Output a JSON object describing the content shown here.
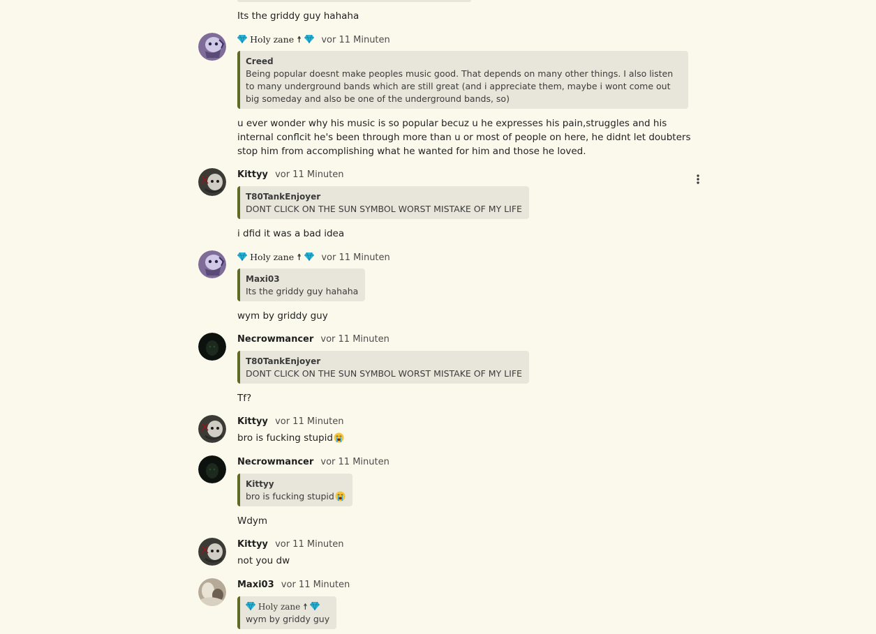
{
  "top_fragment": {
    "text": "Its the griddy guy hahaha"
  },
  "comments": [
    {
      "author": "Holy zane",
      "author_prefix_icon": "diamond-icon",
      "author_suffix": "☨",
      "author_suffix_icon": "diamond-icon",
      "time": "vor 11 Minuten",
      "quote": {
        "author": "Creed",
        "text": "Being popular doesnt make peoples music good. That depends on many other things. I also listen to many underground bands which are still great (and i appreciate them, maybe i wont come out big someday and also be one of the underground bands, so)"
      },
      "text": "u ever wonder why his music is so popular becuz u he expresses his pain,struggles and his internal conflcit he's been through more than u or most of people on here, he didnt let doubters stop him from accomplishing what he wanted for him and those he loved."
    },
    {
      "author": "Kittyy",
      "time": "vor 11 Minuten",
      "quote": {
        "author": "T80TankEnjoyer",
        "text": "DONT CLICK ON THE SUN SYMBOL WORST MISTAKE OF MY LIFE"
      },
      "text": "i dfid it was a bad idea",
      "menu_icon": "more-vertical-icon"
    },
    {
      "author": "Holy zane",
      "author_suffix": "☨",
      "time": "vor 11 Minuten",
      "quote": {
        "author": "Maxi03",
        "text": "Its the griddy guy hahaha"
      },
      "text": "wym by griddy guy"
    },
    {
      "author": "Necrowmancer",
      "time": "vor 11 Minuten",
      "quote": {
        "author": "T80TankEnjoyer",
        "text": "DONT CLICK ON THE SUN SYMBOL WORST MISTAKE OF MY LIFE"
      },
      "text": "Tf?"
    },
    {
      "author": "Kittyy",
      "time": "vor 11 Minuten",
      "text": "bro is fucking stupid",
      "text_emoji": "loudly-crying-face-emoji"
    },
    {
      "author": "Necrowmancer",
      "time": "vor 11 Minuten",
      "quote": {
        "author": "Kittyy",
        "text": "bro is fucking stupid",
        "text_emoji": "loudly-crying-face-emoji"
      },
      "text": "Wdym"
    },
    {
      "author": "Kittyy",
      "time": "vor 11 Minuten",
      "text": "not you dw"
    },
    {
      "author": "Maxi03",
      "time": "vor 11 Minuten",
      "quote": {
        "author": "Holy zane",
        "author_suffix": "☨",
        "text": "wym by griddy guy"
      },
      "text": ""
    }
  ],
  "colors": {
    "background": "#fbf9ec",
    "quote_background": "#e8e6db",
    "quote_border": "#5d6b23",
    "gem": "#2bb3d6"
  }
}
